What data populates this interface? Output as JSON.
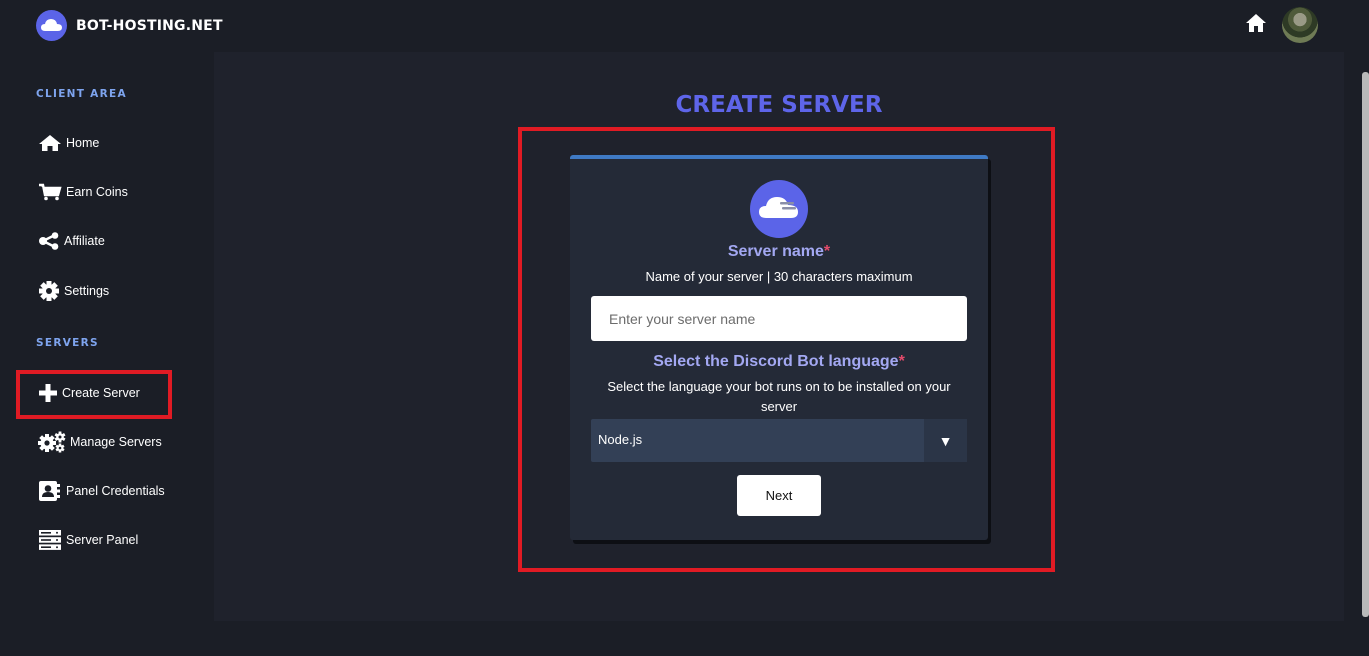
{
  "brand": {
    "name": "BOT-HOSTING.NET",
    "logo_icon": "cloud-icon"
  },
  "header": {
    "home_icon": "home-icon",
    "avatar": "user-avatar"
  },
  "sidebar": {
    "sections": [
      {
        "title": "CLIENT AREA"
      },
      {
        "title": "SERVERS"
      }
    ],
    "items": [
      {
        "label": "Home",
        "icon": "home-icon"
      },
      {
        "label": "Earn Coins",
        "icon": "cart-icon"
      },
      {
        "label": "Affiliate",
        "icon": "share-icon"
      },
      {
        "label": "Settings",
        "icon": "gear-icon"
      },
      {
        "label": "Create Server",
        "icon": "plus-icon"
      },
      {
        "label": "Manage Servers",
        "icon": "gears-icon"
      },
      {
        "label": "Panel Credentials",
        "icon": "contact-card-icon"
      },
      {
        "label": "Server Panel",
        "icon": "server-icon"
      }
    ]
  },
  "main": {
    "title": "CREATE SERVER",
    "form": {
      "logo_icon": "cloud-icon",
      "server_name": {
        "title": "Server name",
        "required_mark": "*",
        "description": "Name of your server | 30 characters maximum",
        "placeholder": "Enter your server name",
        "value": ""
      },
      "language": {
        "title": "Select the Discord Bot language",
        "required_mark": "*",
        "description": "Select the language your bot runs on to be installed on your server",
        "selected": "Node.js",
        "arrow": "▼"
      },
      "next_label": "Next"
    }
  },
  "colors": {
    "accent": "#5e65e9",
    "highlight": "#e01b24",
    "card_border": "#3f7ac4",
    "section_title": "#7ea4ee"
  }
}
